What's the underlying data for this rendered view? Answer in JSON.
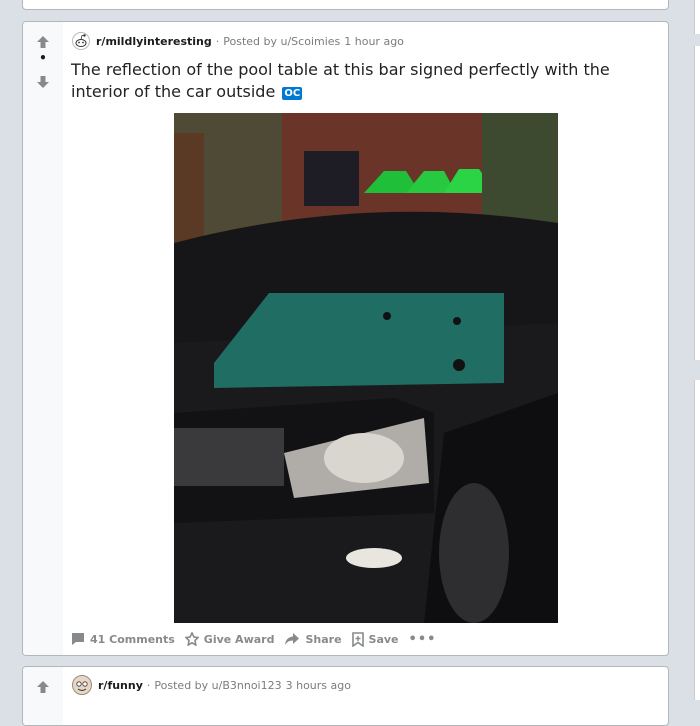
{
  "post": {
    "vote_score": "•",
    "subreddit": "r/mildlyinteresting",
    "posted_by": "Posted by u/Scoimies",
    "time_ago": "1 hour ago",
    "title": "The reflection of the pool table at this bar signed perfectly with the interior of the car outside",
    "flair": "OC",
    "actions": {
      "comments": "41 Comments",
      "award": "Give Award",
      "share": "Share",
      "save": "Save",
      "more": "•••"
    }
  },
  "next_post": {
    "subreddit": "r/funny",
    "posted_by": "Posted by u/B3nnoi123",
    "time_ago": "3 hours ago"
  },
  "colors": {
    "background": "#dae0e6",
    "card": "#ffffff",
    "flair": "#0079d3",
    "meta_text": "#7c7c7c"
  }
}
